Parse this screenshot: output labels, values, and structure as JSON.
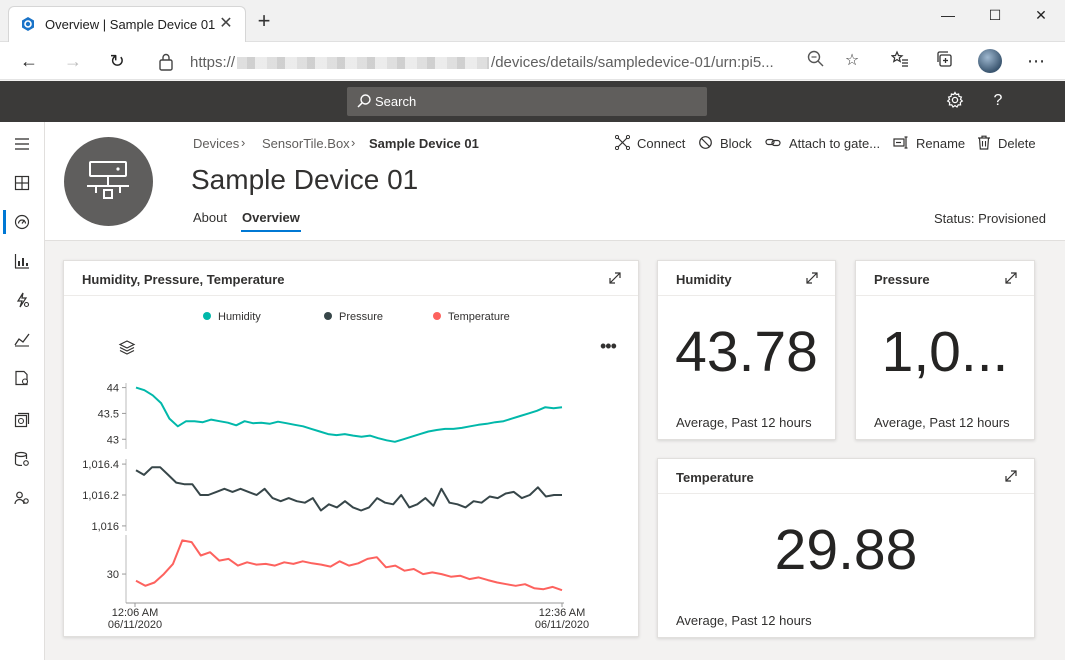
{
  "browser": {
    "tab_title": "Overview | Sample Device 01, str",
    "url_prefix": "https://",
    "url_suffix": "/devices/details/sampledevice-01/urn:pi5..."
  },
  "app": {
    "search_placeholder": "Search"
  },
  "breadcrumb": {
    "items": [
      "Devices",
      "SensorTile.Box",
      "Sample Device 01"
    ]
  },
  "device": {
    "title": "Sample Device 01",
    "tabs": [
      "About",
      "Overview"
    ],
    "status": "Status: Provisioned"
  },
  "commands": {
    "connect": "Connect",
    "block": "Block",
    "attach": "Attach to gate...",
    "rename": "Rename",
    "delete": "Delete"
  },
  "tiles": {
    "line_chart": {
      "title": "Humidity, Pressure, Temperature"
    },
    "humidity": {
      "title": "Humidity",
      "value": "43.78",
      "subtitle": "Average, Past 12 hours"
    },
    "pressure": {
      "title": "Pressure",
      "value": "1,0...",
      "subtitle": "Average, Past 12 hours"
    },
    "temperature": {
      "title": "Temperature",
      "value": "29.88",
      "subtitle": "Average, Past 12 hours"
    }
  },
  "colors": {
    "humidity": "#01b8aa",
    "pressure": "#374649",
    "temperature": "#fd625e",
    "accent": "#0078d4"
  },
  "chart_data": {
    "type": "line",
    "title": "Humidity, Pressure, Temperature",
    "legend": [
      "Humidity",
      "Pressure",
      "Temperature"
    ],
    "legend_position": "top",
    "x_ticks": [
      {
        "time": "12:06 AM",
        "date": "06/11/2020"
      },
      {
        "time": "12:36 AM",
        "date": "06/11/2020"
      }
    ],
    "x_range_minutes": [
      0,
      30
    ],
    "series": [
      {
        "name": "Humidity",
        "ylim": [
          42.85,
          44.05
        ],
        "ticks": [
          {
            "v": 44,
            "label": "44"
          },
          {
            "v": 43.5,
            "label": "43.5"
          },
          {
            "v": 43,
            "label": "43"
          }
        ],
        "values": [
          44.0,
          43.95,
          43.85,
          43.7,
          43.4,
          43.25,
          43.35,
          43.35,
          43.33,
          43.38,
          43.35,
          43.32,
          43.27,
          43.35,
          43.31,
          43.32,
          43.3,
          43.34,
          43.31,
          43.28,
          43.25,
          43.2,
          43.15,
          43.1,
          43.08,
          43.1,
          43.07,
          43.05,
          43.07,
          43.02,
          42.98,
          42.95,
          43.0,
          43.05,
          43.1,
          43.15,
          43.18,
          43.2,
          43.2,
          43.22,
          43.25,
          43.28,
          43.3,
          43.33,
          43.35,
          43.4,
          43.45,
          43.5,
          43.55,
          43.62,
          43.6,
          43.62
        ]
      },
      {
        "name": "Pressure",
        "ylim": [
          1015.98,
          1016.42
        ],
        "ticks": [
          {
            "v": 1016.4,
            "label": "1,016.4"
          },
          {
            "v": 1016.2,
            "label": "1,016.2"
          },
          {
            "v": 1016,
            "label": "1,016"
          }
        ],
        "values": [
          1016.36,
          1016.33,
          1016.38,
          1016.38,
          1016.33,
          1016.28,
          1016.27,
          1016.27,
          1016.2,
          1016.2,
          1016.22,
          1016.24,
          1016.22,
          1016.24,
          1016.22,
          1016.2,
          1016.24,
          1016.18,
          1016.16,
          1016.18,
          1016.16,
          1016.15,
          1016.18,
          1016.1,
          1016.14,
          1016.12,
          1016.16,
          1016.12,
          1016.1,
          1016.12,
          1016.18,
          1016.15,
          1016.14,
          1016.2,
          1016.12,
          1016.14,
          1016.18,
          1016.13,
          1016.24,
          1016.15,
          1016.14,
          1016.12,
          1016.16,
          1016.15,
          1016.19,
          1016.18,
          1016.21,
          1016.22,
          1016.18,
          1016.2,
          1016.25,
          1016.19,
          1016.2,
          1016.2
        ]
      },
      {
        "name": "Temperature",
        "ylim": [
          29.2,
          31.1
        ],
        "ticks": [
          {
            "v": 30,
            "label": "30"
          }
        ],
        "values": [
          29.8,
          29.65,
          29.75,
          30.0,
          30.3,
          31.0,
          30.95,
          30.55,
          30.65,
          30.4,
          30.45,
          30.25,
          30.35,
          30.28,
          30.3,
          30.25,
          30.35,
          30.3,
          30.38,
          30.32,
          30.28,
          30.22,
          30.38,
          30.25,
          30.32,
          30.45,
          30.5,
          30.2,
          30.25,
          30.1,
          30.15,
          30.0,
          30.05,
          30.0,
          29.92,
          29.95,
          29.85,
          29.9,
          29.82,
          29.75,
          29.7,
          29.65,
          29.7,
          29.58,
          29.55,
          29.62,
          29.52
        ]
      }
    ]
  }
}
